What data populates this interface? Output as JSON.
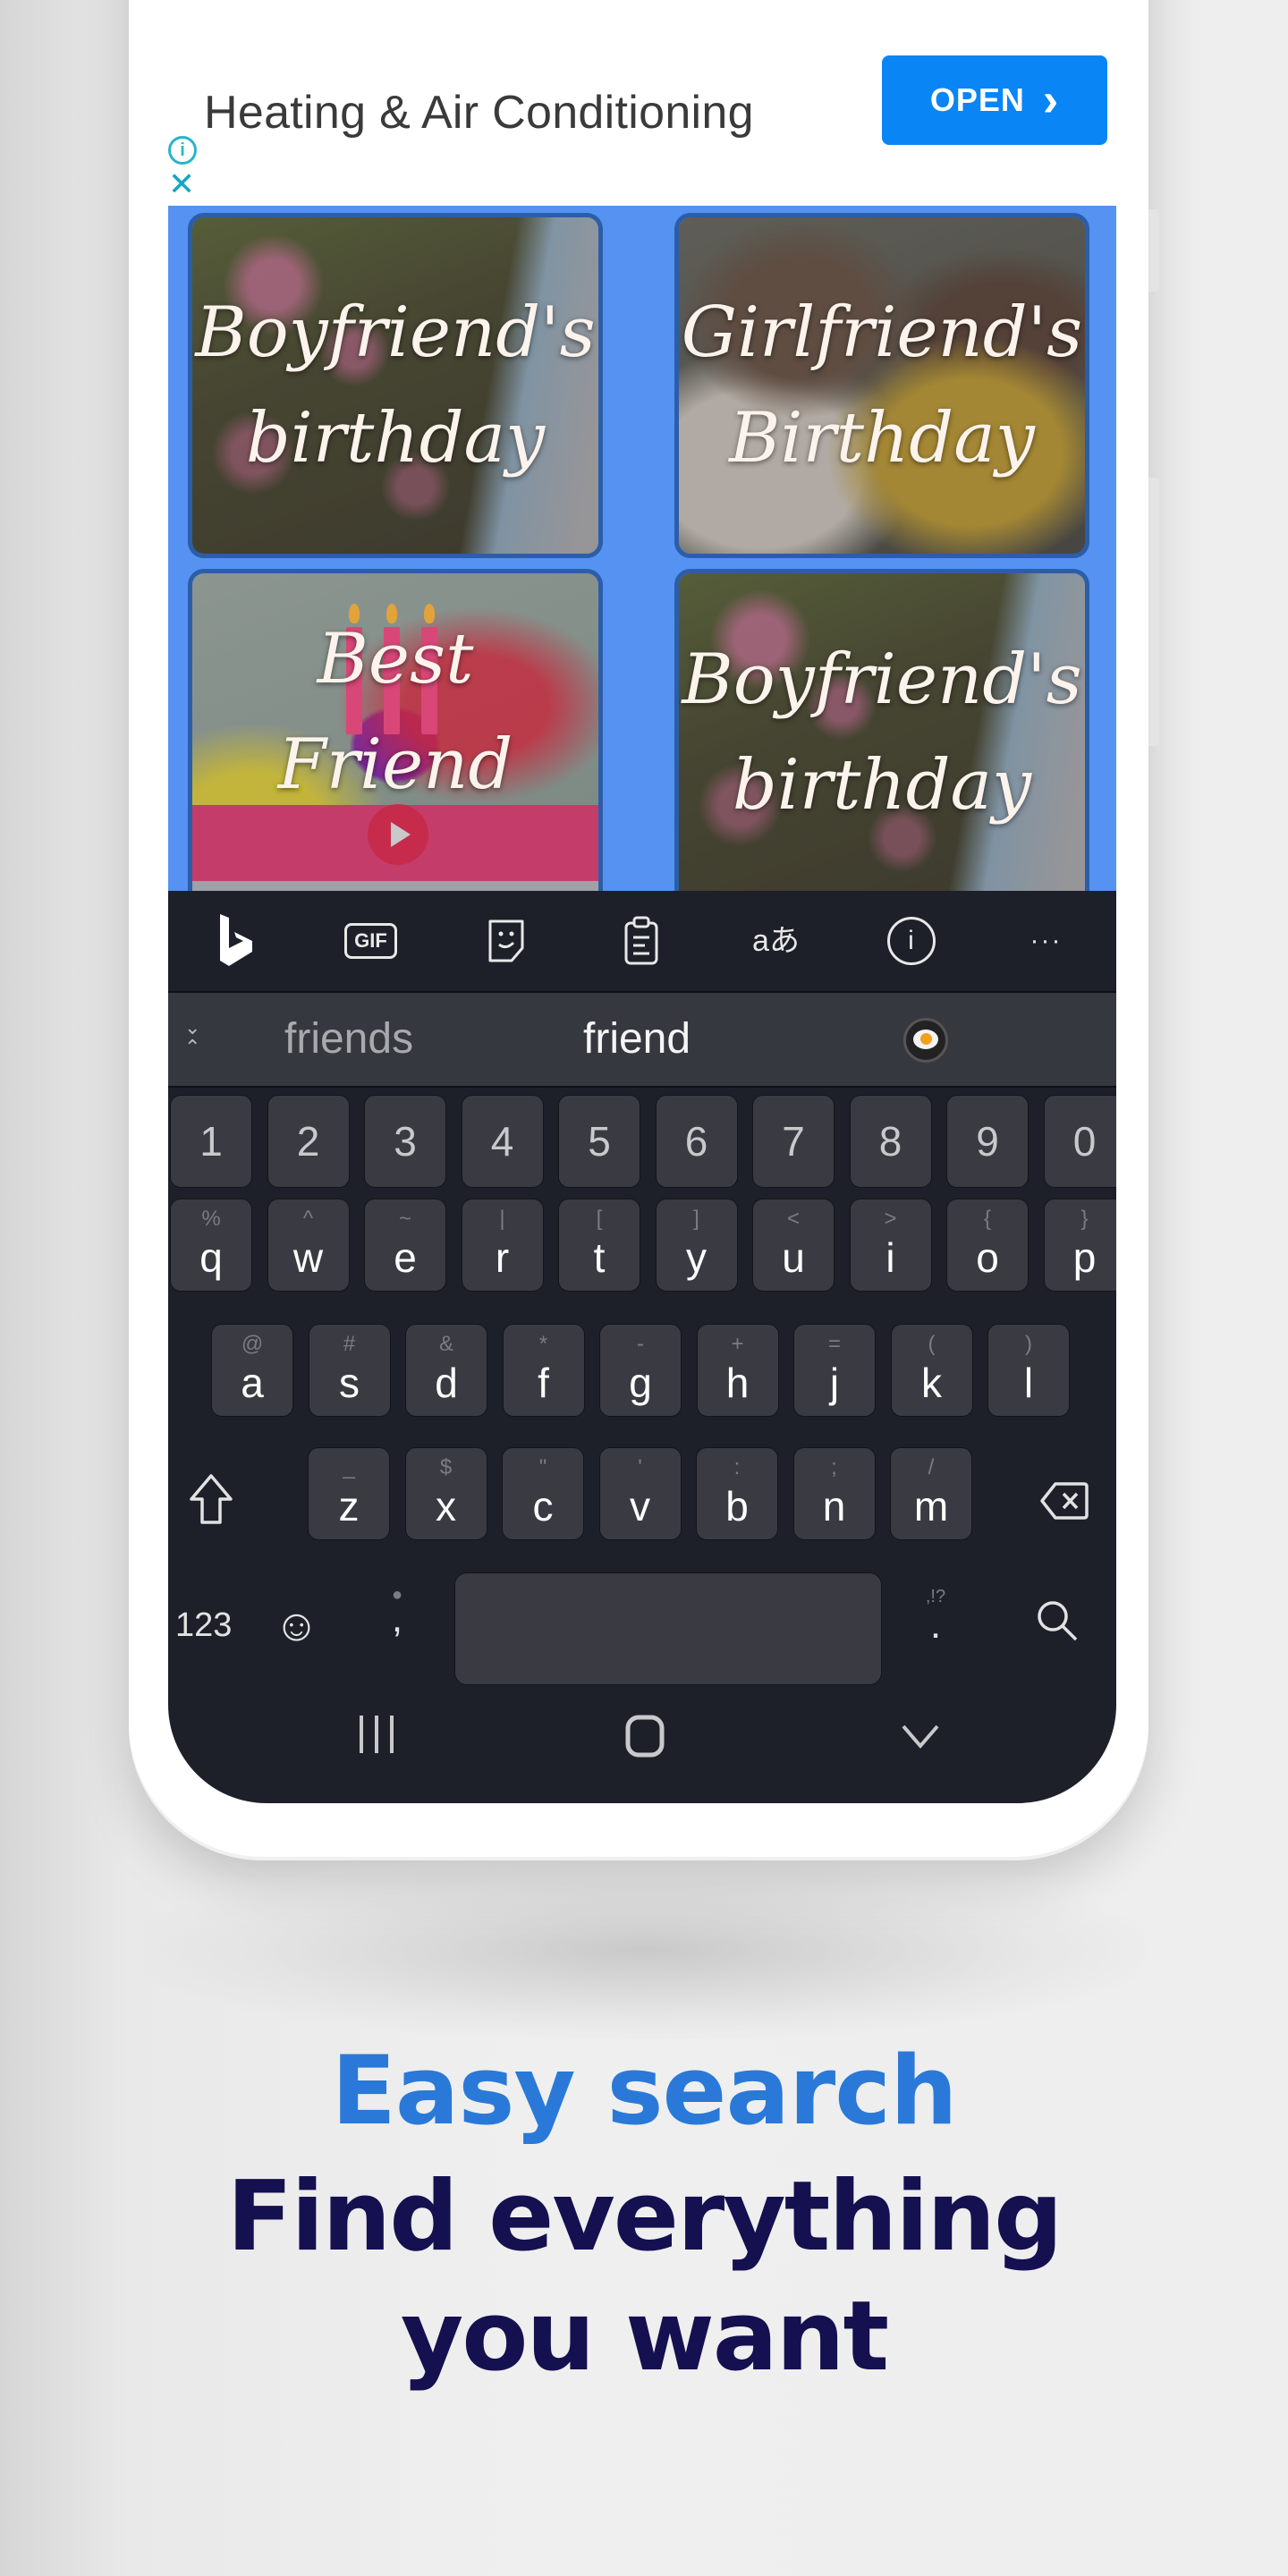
{
  "ad": {
    "title": "Heating & Air Conditioning",
    "open_label": "OPEN",
    "open_chevron": "›",
    "info_icon": "i",
    "close_icon": "✕",
    "accent_color": "#0a85f5"
  },
  "grid": {
    "background_color": "#5592f2",
    "cards": [
      {
        "label": "Boyfriend's birthday",
        "image": "holding-hands"
      },
      {
        "label": "Girlfriend's Birthday",
        "image": "couple"
      },
      {
        "label": "Best Friend",
        "image": "birthday-cake"
      },
      {
        "label": "Boyfriend's birthday",
        "image": "holding-hands"
      }
    ]
  },
  "keyboard": {
    "toolbar": [
      {
        "name": "bing-icon",
        "glyph": "b"
      },
      {
        "name": "gif-icon",
        "glyph": "GIF"
      },
      {
        "name": "sticker-icon",
        "glyph": ""
      },
      {
        "name": "clipboard-icon",
        "glyph": ""
      },
      {
        "name": "translate-icon",
        "glyph": "aあ"
      },
      {
        "name": "info-icon",
        "glyph": "i"
      },
      {
        "name": "more-icon",
        "glyph": "···"
      }
    ],
    "suggestions": {
      "collapse_icon": "⌄⌃",
      "items": [
        "friends",
        "friend"
      ],
      "emoji": "fried-egg"
    },
    "number_row": [
      "1",
      "2",
      "3",
      "4",
      "5",
      "6",
      "7",
      "8",
      "9",
      "0"
    ],
    "row1": [
      {
        "key": "q",
        "alt": "%"
      },
      {
        "key": "w",
        "alt": "^"
      },
      {
        "key": "e",
        "alt": "~"
      },
      {
        "key": "r",
        "alt": "|"
      },
      {
        "key": "t",
        "alt": "["
      },
      {
        "key": "y",
        "alt": "]"
      },
      {
        "key": "u",
        "alt": "<"
      },
      {
        "key": "i",
        "alt": ">"
      },
      {
        "key": "o",
        "alt": "{"
      },
      {
        "key": "p",
        "alt": "}"
      }
    ],
    "row2": [
      {
        "key": "a",
        "alt": "@"
      },
      {
        "key": "s",
        "alt": "#"
      },
      {
        "key": "d",
        "alt": "&"
      },
      {
        "key": "f",
        "alt": "*"
      },
      {
        "key": "g",
        "alt": "-"
      },
      {
        "key": "h",
        "alt": "+"
      },
      {
        "key": "j",
        "alt": "="
      },
      {
        "key": "k",
        "alt": "("
      },
      {
        "key": "l",
        "alt": ")"
      }
    ],
    "row3": [
      {
        "key": "z",
        "alt": "_"
      },
      {
        "key": "x",
        "alt": "$"
      },
      {
        "key": "c",
        "alt": "\""
      },
      {
        "key": "v",
        "alt": "'"
      },
      {
        "key": "b",
        "alt": ":"
      },
      {
        "key": "n",
        "alt": ";"
      },
      {
        "key": "m",
        "alt": "/"
      }
    ],
    "shift_icon": "⇧",
    "backspace_icon": "⌫",
    "numbers_label": "123",
    "emoji_icon": "☺",
    "comma_label": ",",
    "mic_icon": "🎤",
    "period_label": ".",
    "punct_alt": ",!?",
    "search_icon": "⚲"
  },
  "navbar": {
    "recents_icon": "|||",
    "home_icon": "▢",
    "back_icon": "⌄"
  },
  "captions": {
    "headline": "Easy search",
    "subline": "Find everything you want",
    "headline_color": "#2a79d8",
    "subline_color": "#15104f"
  }
}
